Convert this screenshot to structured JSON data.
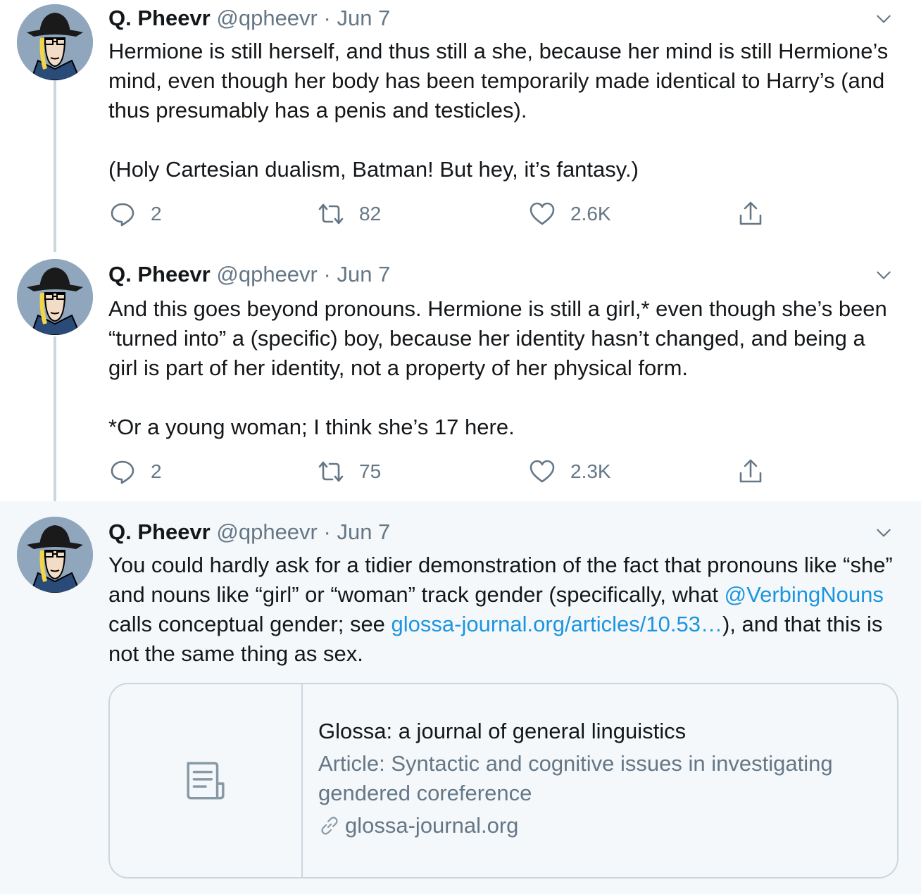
{
  "tweets": [
    {
      "display_name": "Q. Pheevr",
      "handle": "@qpheevr",
      "separator": "·",
      "date": "Jun 7",
      "paragraphs": [
        "Hermione is still herself, and thus still a she, because her mind is still Hermione’s mind, even though her body has been temporarily made identical to Harry’s (and thus presumably has a penis and testicles).",
        "(Holy Cartesian dualism, Batman! But hey, it’s fantasy.)"
      ],
      "replies": "2",
      "retweets": "82",
      "likes": "2.6K"
    },
    {
      "display_name": "Q. Pheevr",
      "handle": "@qpheevr",
      "separator": "·",
      "date": "Jun 7",
      "paragraphs": [
        "And this goes beyond pronouns. Hermione is still a girl,* even though she’s been “turned into” a (specific) boy, because her identity hasn’t changed, and being a girl is part of her identity, not a property of her physical form.",
        "*Or a young woman; I think she’s 17 here."
      ],
      "replies": "2",
      "retweets": "75",
      "likes": "2.3K"
    },
    {
      "display_name": "Q. Pheevr",
      "handle": "@qpheevr",
      "separator": "·",
      "date": "Jun 7",
      "text_before_mention": "You could hardly ask for a tidier demonstration of the fact that pronouns like “she” and nouns like “girl” or “woman” track gender (specifically, what ",
      "mention": "@VerbingNouns",
      "text_after_mention": " calls conceptual gender; see ",
      "url_text": "glossa-journal.org/articles/10.53…",
      "text_end": "), and that this is not the same thing as sex.",
      "card": {
        "title": "Glossa: a journal of general linguistics",
        "description": "Article: Syntactic and cognitive issues in investigating gendered coreference",
        "domain": "glossa-journal.org",
        "thumb_icon": "document-icon",
        "domain_icon": "link-icon"
      }
    }
  ],
  "colors": {
    "text": "#14171a",
    "secondary": "#657786",
    "link": "#1b95e0",
    "thread_line": "#ccd6dd",
    "highlight_bg": "#f5f8fa"
  }
}
